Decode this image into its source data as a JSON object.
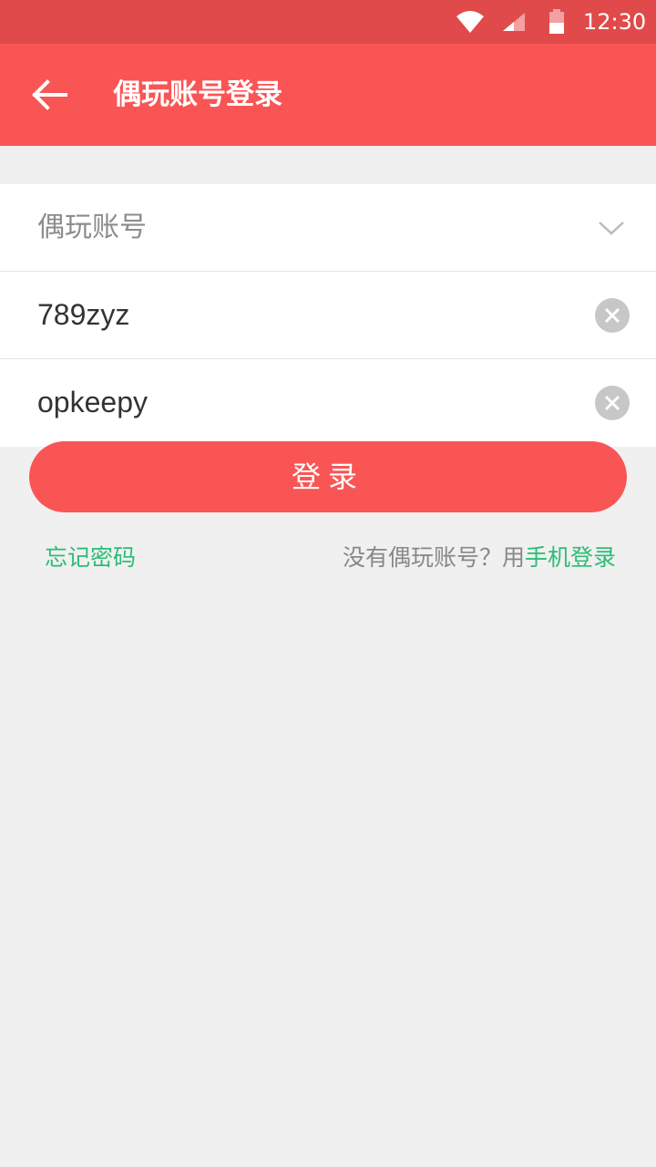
{
  "status_bar": {
    "time": "12:30"
  },
  "app_bar": {
    "title": "偶玩账号登录"
  },
  "form": {
    "account_type": {
      "placeholder": "偶玩账号"
    },
    "username": {
      "value": "789zyz"
    },
    "password": {
      "value": "opkeepy"
    }
  },
  "login_button": {
    "label": "登录"
  },
  "links": {
    "forgot_password": "忘记密码",
    "no_account_prefix": "没有偶玩账号？用",
    "phone_login": "手机登录"
  },
  "colors": {
    "status_bar": "#e04a4a",
    "app_bar": "#f95555",
    "accent_green": "#2bbd76",
    "background": "#f0f0f0"
  }
}
